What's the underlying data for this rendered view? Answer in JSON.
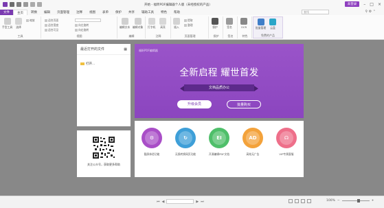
{
  "window": {
    "title": "开始 - 福昕PDF编辑器个人版（未经授权的产品）",
    "login": "未登录"
  },
  "tabs": [
    {
      "label": "文件"
    },
    {
      "label": "主页"
    },
    {
      "label": "转换"
    },
    {
      "label": "编辑"
    },
    {
      "label": "页面管理"
    },
    {
      "label": "注释"
    },
    {
      "label": "视图"
    },
    {
      "label": "表单"
    },
    {
      "label": "保护"
    },
    {
      "label": "共享"
    },
    {
      "label": "辅助工具"
    },
    {
      "label": "特色"
    },
    {
      "label": "帮助"
    }
  ],
  "search": {
    "placeholder": "查找"
  },
  "ribbon": {
    "groups": [
      {
        "label": "工具"
      },
      {
        "label": "视图"
      },
      {
        "label": "编辑"
      },
      {
        "label": "注释"
      },
      {
        "label": "页面管理"
      },
      {
        "label": "保护"
      },
      {
        "label": "签名"
      },
      {
        "label": "特色"
      },
      {
        "label": "免费的产品"
      }
    ],
    "buttons": {
      "hand": "手型工具",
      "select": "选择",
      "zoom": "缩放",
      "fit_page": "适合页面",
      "fit_width": "适合宽度",
      "fit_visible": "适合可见",
      "rotate_left": "向左旋转",
      "rotate_right": "向右旋转",
      "edit_text": "编辑文本",
      "edit_object": "编辑对象",
      "typewriter": "打字机",
      "highlight": "高亮",
      "insert": "插入",
      "extract": "提取",
      "organize": "整理",
      "protect": "保护",
      "sign": "签名",
      "ocr": "OCR",
      "batch": "批量管理",
      "cloud": "云盘"
    }
  },
  "recent": {
    "title": "最近打开的文件",
    "open": "打开..."
  },
  "qr": {
    "caption": "关注公众号，获取更多帮助"
  },
  "banner": {
    "logo": "福昕PDF编辑器",
    "headline": "全新启程 耀世首发",
    "tagline": "文档品质办公",
    "btn_upgrade": "升级会员",
    "btn_buy": "批量购买"
  },
  "features": [
    {
      "label": "截屏体验功能",
      "icon": "settings-icon",
      "color": "#a94ec7"
    },
    {
      "label": "无损转换网页功能",
      "icon": "convert-icon",
      "color": "#3e9fd8"
    },
    {
      "label": "开源编辑PDF文档",
      "icon": "edit-icon",
      "color": "#4fbf6a"
    },
    {
      "label": "高效无广告",
      "icon": "ad-icon",
      "color": "#f3a23b"
    },
    {
      "label": "VIP专属客服",
      "icon": "headset-icon",
      "color": "#ee6f8a"
    }
  ],
  "status": {
    "zoom": "100%",
    "page_nav": "◀ ▶"
  }
}
